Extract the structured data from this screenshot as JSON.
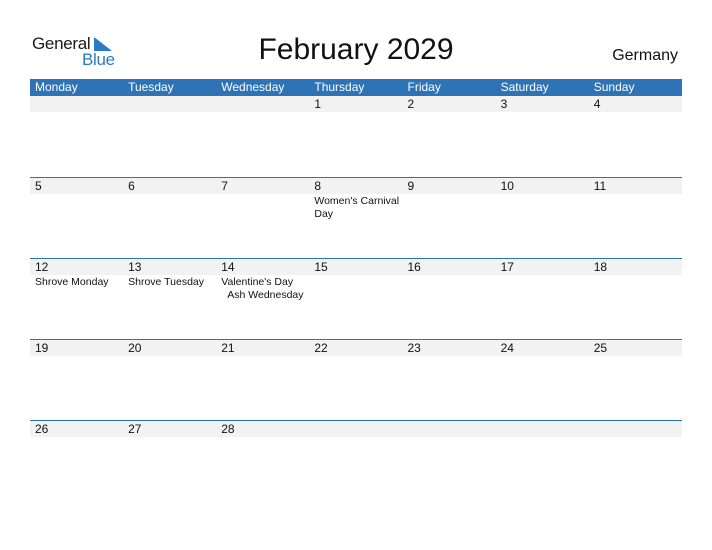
{
  "logo": {
    "word1": "General",
    "word2": "Blue"
  },
  "title": "February 2029",
  "country": "Germany",
  "colors": {
    "header_bg": "#2e73b5",
    "date_band": "#f2f2f2",
    "logo_blue": "#2a7bc4"
  },
  "weekdays": [
    "Monday",
    "Tuesday",
    "Wednesday",
    "Thursday",
    "Friday",
    "Saturday",
    "Sunday"
  ],
  "weeks": [
    {
      "days": [
        {
          "num": "",
          "events": []
        },
        {
          "num": "",
          "events": []
        },
        {
          "num": "",
          "events": []
        },
        {
          "num": "1",
          "events": []
        },
        {
          "num": "2",
          "events": []
        },
        {
          "num": "3",
          "events": []
        },
        {
          "num": "4",
          "events": []
        }
      ]
    },
    {
      "days": [
        {
          "num": "5",
          "events": []
        },
        {
          "num": "6",
          "events": []
        },
        {
          "num": "7",
          "events": []
        },
        {
          "num": "8",
          "events": [
            "Women's Carnival Day"
          ]
        },
        {
          "num": "9",
          "events": []
        },
        {
          "num": "10",
          "events": []
        },
        {
          "num": "11",
          "events": []
        }
      ]
    },
    {
      "days": [
        {
          "num": "12",
          "events": [
            "Shrove Monday"
          ]
        },
        {
          "num": "13",
          "events": [
            "Shrove Tuesday"
          ]
        },
        {
          "num": "14",
          "events": [
            "Valentine's Day",
            "Ash Wednesday"
          ]
        },
        {
          "num": "15",
          "events": []
        },
        {
          "num": "16",
          "events": []
        },
        {
          "num": "17",
          "events": []
        },
        {
          "num": "18",
          "events": []
        }
      ]
    },
    {
      "days": [
        {
          "num": "19",
          "events": []
        },
        {
          "num": "20",
          "events": []
        },
        {
          "num": "21",
          "events": []
        },
        {
          "num": "22",
          "events": []
        },
        {
          "num": "23",
          "events": []
        },
        {
          "num": "24",
          "events": []
        },
        {
          "num": "25",
          "events": []
        }
      ]
    },
    {
      "days": [
        {
          "num": "26",
          "events": []
        },
        {
          "num": "27",
          "events": []
        },
        {
          "num": "28",
          "events": []
        },
        {
          "num": "",
          "events": []
        },
        {
          "num": "",
          "events": []
        },
        {
          "num": "",
          "events": []
        },
        {
          "num": "",
          "events": []
        }
      ]
    }
  ]
}
